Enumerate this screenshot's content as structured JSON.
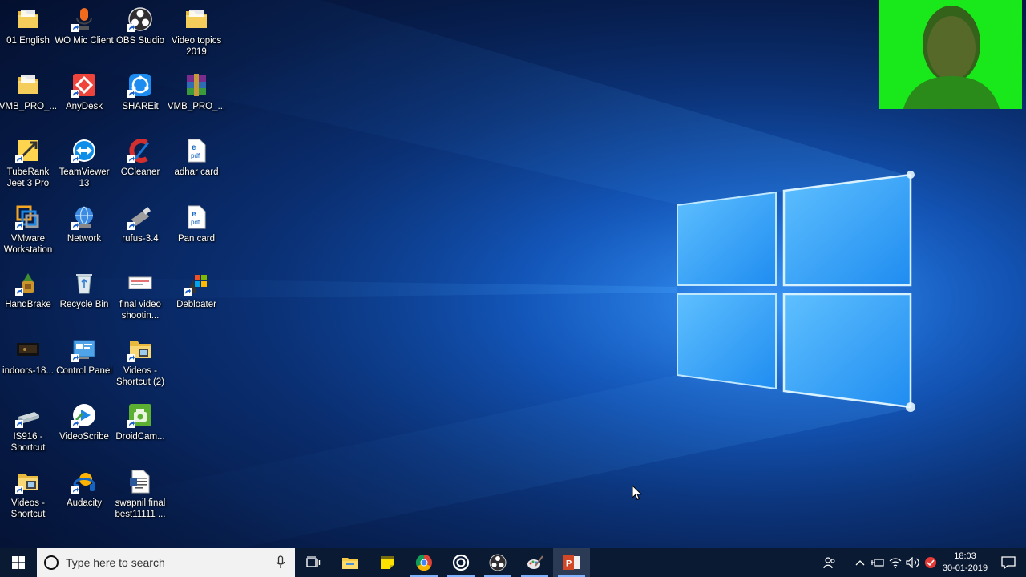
{
  "desktop": {
    "icons": [
      {
        "label": "01 English",
        "icon": "folder-icon"
      },
      {
        "label": "WO Mic Client",
        "icon": "microphone-app-icon"
      },
      {
        "label": "OBS Studio",
        "icon": "obs-icon"
      },
      {
        "label": "Video topics 2019",
        "icon": "folder-icon"
      },
      {
        "label": "VMB_PRO_...",
        "icon": "folder-icon"
      },
      {
        "label": "AnyDesk",
        "icon": "anydesk-icon"
      },
      {
        "label": "SHAREit",
        "icon": "shareit-icon"
      },
      {
        "label": "VMB_PRO_...",
        "icon": "winrar-icon"
      },
      {
        "label": "TubeRank Jeet 3 Pro",
        "icon": "tuberank-icon"
      },
      {
        "label": "TeamViewer 13",
        "icon": "teamviewer-icon"
      },
      {
        "label": "CCleaner",
        "icon": "ccleaner-icon"
      },
      {
        "label": "adhar card",
        "icon": "pdf-file-icon"
      },
      {
        "label": "VMware Workstation",
        "icon": "vmware-icon"
      },
      {
        "label": "Network",
        "icon": "network-icon"
      },
      {
        "label": "rufus-3.4",
        "icon": "rufus-icon"
      },
      {
        "label": "Pan card",
        "icon": "pdf-file-icon"
      },
      {
        "label": "HandBrake",
        "icon": "handbrake-icon"
      },
      {
        "label": "Recycle Bin",
        "icon": "recycle-bin-icon"
      },
      {
        "label": "final video shootin...",
        "icon": "image-file-icon"
      },
      {
        "label": "Debloater",
        "icon": "debloater-icon"
      },
      {
        "label": "indoors-18...",
        "icon": "video-file-icon"
      },
      {
        "label": "Control Panel",
        "icon": "control-panel-icon"
      },
      {
        "label": "Videos - Shortcut (2)",
        "icon": "videos-folder-icon"
      },
      {
        "label": "IS916 - Shortcut",
        "icon": "drive-shortcut-icon"
      },
      {
        "label": "VideoScribe",
        "icon": "videoscribe-icon"
      },
      {
        "label": "DroidCam...",
        "icon": "droidcam-icon"
      },
      {
        "label": "Videos - Shortcut",
        "icon": "videos-folder-icon"
      },
      {
        "label": "Audacity",
        "icon": "audacity-icon"
      },
      {
        "label": "swapnil final best11111 ...",
        "icon": "document-file-icon"
      }
    ]
  },
  "taskbar": {
    "search_placeholder": "Type here to search",
    "apps": [
      {
        "name": "task-view",
        "icon": "task-view-icon"
      },
      {
        "name": "file-explorer",
        "icon": "folder-icon"
      },
      {
        "name": "sticky-notes",
        "icon": "sticky-notes-icon"
      },
      {
        "name": "chrome",
        "icon": "chrome-icon"
      },
      {
        "name": "obs-tray",
        "icon": "record-icon"
      },
      {
        "name": "obs-studio",
        "icon": "obs-icon"
      },
      {
        "name": "paint-app",
        "icon": "paint-icon"
      },
      {
        "name": "powerpoint",
        "icon": "powerpoint-icon"
      }
    ],
    "clock": {
      "time": "18:03",
      "date": "30-01-2019"
    }
  },
  "colors": {
    "taskbar_bg": "#0b1a33",
    "webcam_green": "#19e81b",
    "accent": "#7fb3ff"
  }
}
